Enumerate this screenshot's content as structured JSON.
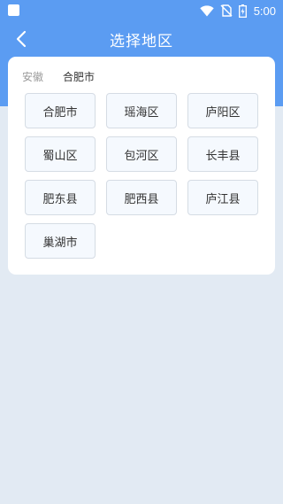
{
  "status_bar": {
    "time": "5:00",
    "icons": [
      "notification-square-icon",
      "wifi-icon",
      "no-sim-icon",
      "battery-icon"
    ]
  },
  "header": {
    "title": "选择地区",
    "back_icon": "chevron-left-icon"
  },
  "colors": {
    "header_blue": "#5b9cf2",
    "page_bg": "#e2eaf3",
    "card_bg": "#ffffff",
    "cell_bg": "#f5f9fe",
    "cell_border": "#d5dce4"
  },
  "breadcrumb": {
    "province": "安徽",
    "city": "合肥市"
  },
  "districts": [
    {
      "label": "合肥市"
    },
    {
      "label": "瑶海区"
    },
    {
      "label": "庐阳区"
    },
    {
      "label": "蜀山区"
    },
    {
      "label": "包河区"
    },
    {
      "label": "长丰县"
    },
    {
      "label": "肥东县"
    },
    {
      "label": "肥西县"
    },
    {
      "label": "庐江县"
    },
    {
      "label": "巢湖市"
    }
  ]
}
